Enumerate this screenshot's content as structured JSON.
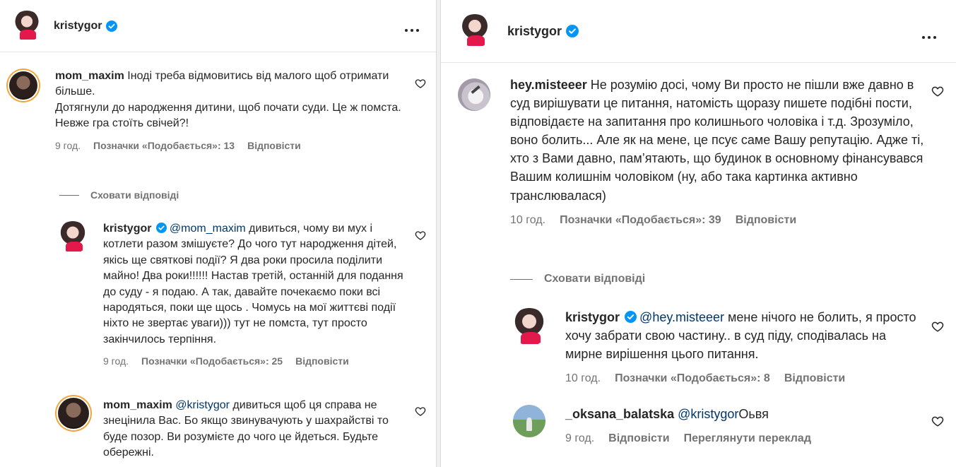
{
  "left": {
    "header": {
      "username": "kristygor"
    },
    "comment1": {
      "username": "mom_maxim",
      "text1": "Іноді треба відмовитись від малого щоб отримати більше.",
      "text2": "Дотягнули до народження дитини, щоб почати суди. Це ж помста.",
      "text3": "Невже гра стоїть свічей?!",
      "time": "9 год.",
      "likes": "Позначки «Подобається»: 13",
      "reply": "Відповісти"
    },
    "hide_replies": "Сховати відповіді",
    "reply1": {
      "username": "kristygor",
      "mention": "@mom_maxim",
      "text": " дивиться, чому ви мух і котлети разом змішуєте? До чого тут народження дітей, якісь ще святкові події? Я два роки просила поділити майно! Два роки!!!!!! Настав третій, останній для подання до суду - я подаю. А так, давайте почекаємо поки всі народяться, поки ще щось . Чомусь на мої життєві події ніхто не звертає уваги))) тут не помста, тут просто закінчилось терпіння.",
      "time": "9 год.",
      "likes": "Позначки «Подобається»: 25",
      "reply": "Відповісти"
    },
    "reply2": {
      "username": "mom_maxim",
      "mention": "@kristygor",
      "text": " дивиться щоб ця справа не знецінила Вас. Бо якщо звинувачують у шахрайстві то буде позор. Ви розумієте до чого це йдеться. Будьте обережні."
    }
  },
  "right": {
    "header": {
      "username": "kristygor"
    },
    "comment1": {
      "username": "hey.misteeer",
      "text": " Не розумію досі, чому Ви просто не пішли вже давно в суд вирішувати це питання, натомість щоразу пишете подібні пости, відповідаєте на запитання про колишнього чоловіка і т.д. Зрозуміло, воно болить... Але як на мене, це псує саме Вашу репутацію. Адже ті, хто з Вами давно, пам’ятають, що будинок в основному фінансувався Вашим колишнім чоловіком (ну, або така картинка активно транслювалася)",
      "time": "10 год.",
      "likes": "Позначки «Подобається»: 39",
      "reply": "Відповісти"
    },
    "hide_replies": "Сховати відповіді",
    "reply1": {
      "username": "kristygor",
      "mention": "@hey.misteeer",
      "text": " мене нічого не болить, я просто хочу забрати свою частину.. в суд піду, сподівалась на мирне вирішення цього питання.",
      "time": "10 год.",
      "likes": "Позначки «Подобається»: 8",
      "reply": "Відповісти"
    },
    "reply2": {
      "username": "_oksana_balatska",
      "mention": "@kristygor",
      "text": "Оьвя",
      "time": "9 год.",
      "reply": "Відповісти",
      "translate": "Переглянути переклад"
    }
  },
  "colors": {
    "verified": "#0095f6",
    "mention": "#00376b",
    "meta": "#737373"
  },
  "icons": [
    "verified-badge-icon",
    "more-options-icon",
    "heart-icon"
  ]
}
